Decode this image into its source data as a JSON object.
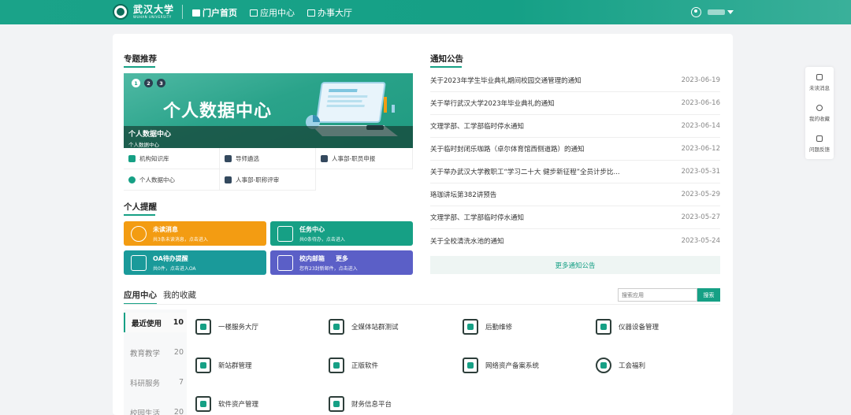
{
  "header": {
    "logo_cn": "武汉大学",
    "logo_en": "WUHAN UNIVERSITY",
    "nav": [
      {
        "label": "门户首页",
        "icon": "home-icon"
      },
      {
        "label": "应用中心",
        "icon": "apps-icon"
      },
      {
        "label": "办事大厅",
        "icon": "hall-icon"
      }
    ]
  },
  "topics": {
    "title": "专题推荐",
    "banner": {
      "dots": [
        "1",
        "2",
        "3"
      ],
      "big_text": "个人数据中心",
      "caption": "个人数据中心",
      "sub_caption": "个人数据中心"
    },
    "links": [
      {
        "label": "机构知识库",
        "color": "#16a085"
      },
      {
        "label": "导师遴选",
        "color": "#34495e"
      },
      {
        "label": "人事部-职员申报",
        "color": "#34495e"
      },
      {
        "label": "个人数据中心",
        "color": "#16a085"
      },
      {
        "label": "人事部-职称评审",
        "color": "#34495e"
      }
    ]
  },
  "reminders": {
    "title": "个人提醒",
    "items": [
      {
        "title": "未读消息",
        "desc": "共3条未读消息，点击进入",
        "color": "#f39c12"
      },
      {
        "title": "任务中心",
        "desc": "共0条待办，点击进入",
        "color": "#16a085"
      },
      {
        "title": "OA待办提醒",
        "desc": "共0件，点击进入OA",
        "color": "#1a9a9a"
      },
      {
        "title": "校内邮箱",
        "more": "更多",
        "desc": "您有23封新邮件，点击进入",
        "color": "#5b5fc7"
      }
    ]
  },
  "notices": {
    "title": "通知公告",
    "items": [
      {
        "text": "关于2023年学生毕业典礼期间校园交通管理的通知",
        "date": "2023-06-19"
      },
      {
        "text": "关于举行武汉大学2023年毕业典礼的通知",
        "date": "2023-06-16"
      },
      {
        "text": "文理学部、工学部临时停水通知",
        "date": "2023-06-14"
      },
      {
        "text": "关于临时封闭乐咖路（卓尔体育馆西侧道路）的通知",
        "date": "2023-06-12"
      },
      {
        "text": "关于举办武汉大学教职工“学习二十大 健步新征程”全员计步比...",
        "date": "2023-05-31"
      },
      {
        "text": "珞珈讲坛第382讲预告",
        "date": "2023-05-29"
      },
      {
        "text": "文理学部、工学部临时停水通知",
        "date": "2023-05-27"
      },
      {
        "text": "关于全校清洗水池的通知",
        "date": "2023-05-24"
      }
    ],
    "more": "更多通知公告"
  },
  "app_center": {
    "tabs": [
      "应用中心",
      "我的收藏"
    ],
    "search_placeholder": "搜索应用",
    "search_button": "搜索",
    "categories": [
      {
        "name": "最近使用",
        "count": "10"
      },
      {
        "name": "教育教学",
        "count": "20"
      },
      {
        "name": "科研服务",
        "count": "7"
      },
      {
        "name": "校园生活",
        "count": "20"
      }
    ],
    "apps": [
      {
        "name": "一楼服务大厅"
      },
      {
        "name": "全媒体站群测试"
      },
      {
        "name": "后勤维修"
      },
      {
        "name": "仪器设备管理"
      },
      {
        "name": "新站群管理"
      },
      {
        "name": "正版软件"
      },
      {
        "name": "网络资产备案系统"
      },
      {
        "name": "工会福利"
      },
      {
        "name": "软件资产管理"
      },
      {
        "name": "财务信息平台"
      }
    ]
  },
  "side_float": [
    {
      "label": "未读消息",
      "icon": "message-icon"
    },
    {
      "label": "我的收藏",
      "icon": "star-icon"
    },
    {
      "label": "问题反馈",
      "icon": "feedback-icon"
    }
  ]
}
